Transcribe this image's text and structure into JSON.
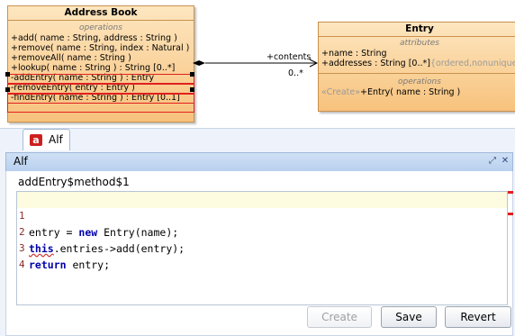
{
  "diagram": {
    "address_book": {
      "title": "Address Book",
      "section": "operations",
      "ops": [
        {
          "sig": "+add( name : String, address : String )",
          "type": ""
        },
        {
          "sig": "+remove( name : String, index : Natural )",
          "type": ""
        },
        {
          "sig": "+removeAll( name : String )",
          "type": ""
        },
        {
          "sig": "+lookup( name : String ) : String [0..*]",
          "type": ""
        },
        {
          "sig": "-addEntry( name : String ) : Entry",
          "type": ""
        },
        {
          "sig": "-removeEntry( entry : Entry )",
          "type": ""
        },
        {
          "sig": "-findEntry( name : String ) : Entry [0..1]",
          "type": ""
        }
      ]
    },
    "entry": {
      "title": "Entry",
      "attr_section": "attributes",
      "attrs": [
        {
          "name": "+name",
          "type": " : String"
        },
        {
          "name": "+addresses",
          "type": " : String [0..*]",
          "extra": "{ordered,nonunique}"
        }
      ],
      "op_section": "operations",
      "op_stereo": "«Create»",
      "op_sig": "+Entry( name : String )"
    },
    "association": {
      "role": "+contents",
      "multiplicity": "0..*"
    }
  },
  "panel": {
    "tab_label": "Alf",
    "header_label": "Alf",
    "method_name": "addEntry$method$1",
    "code_lines": [
      {
        "num": "1",
        "parts": [
          {
            "t": "entry = "
          },
          {
            "t": "new",
            "k": true
          },
          {
            "t": " Entry(name);"
          }
        ]
      },
      {
        "num": "2",
        "parts": [
          {
            "t": "this",
            "k": true
          },
          {
            "t": ".entries->add(entry);"
          }
        ]
      },
      {
        "num": "3",
        "parts": [
          {
            "t": "return",
            "k": true
          },
          {
            "t": " entry;"
          }
        ]
      },
      {
        "num": "4",
        "parts": [
          {
            "t": ""
          }
        ]
      }
    ],
    "buttons": {
      "create": "Create",
      "save": "Save",
      "revert": "Revert"
    }
  }
}
